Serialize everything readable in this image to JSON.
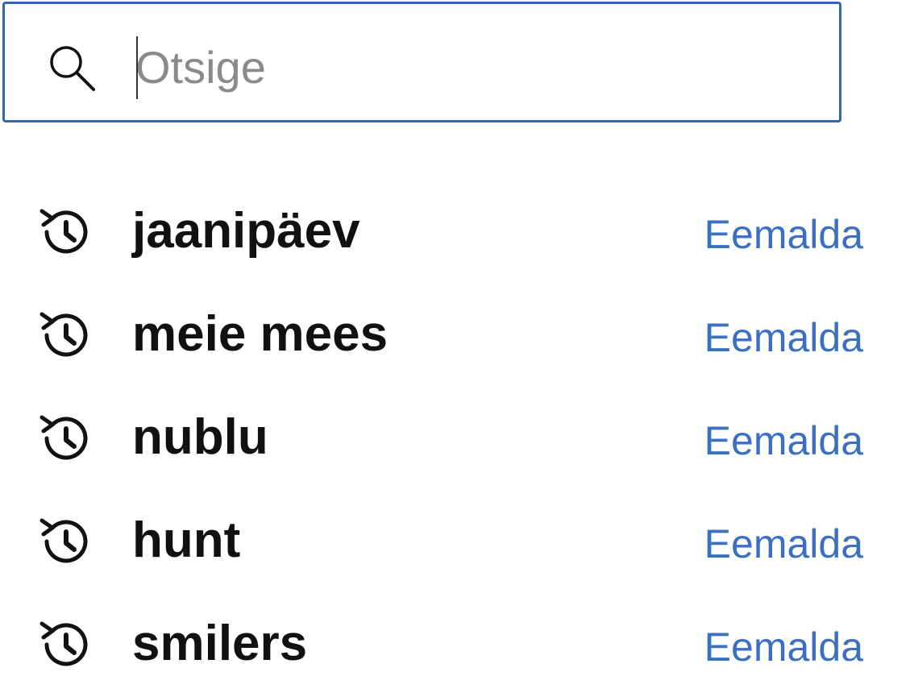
{
  "search": {
    "placeholder": "Otsige",
    "value": ""
  },
  "icons": {
    "search": "search-icon",
    "history": "history-icon"
  },
  "colors": {
    "search_border": "#2f65b5",
    "link": "#3a6fc4",
    "text": "#111111",
    "placeholder": "#8a8a8a"
  },
  "history": {
    "items": [
      {
        "text": "jaanipäev",
        "remove_label": "Eemalda"
      },
      {
        "text": "meie mees",
        "remove_label": "Eemalda"
      },
      {
        "text": "nublu",
        "remove_label": "Eemalda"
      },
      {
        "text": "hunt",
        "remove_label": "Eemalda"
      },
      {
        "text": "smilers",
        "remove_label": "Eemalda"
      }
    ]
  }
}
